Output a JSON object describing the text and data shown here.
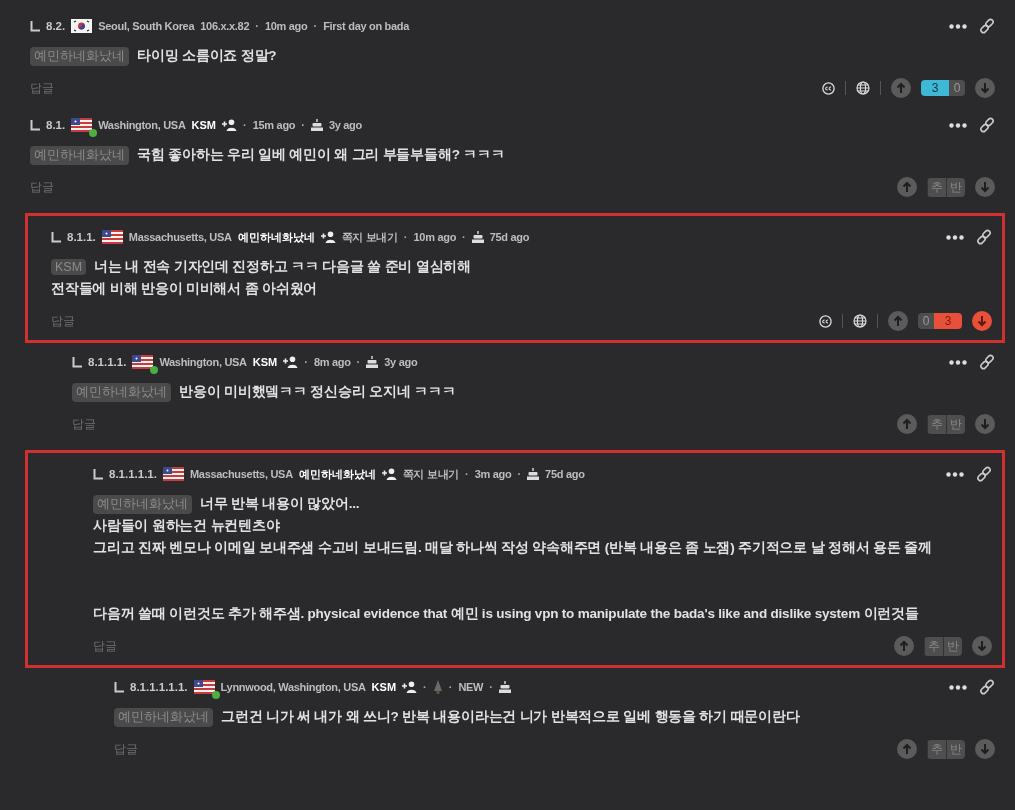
{
  "comments": [
    {
      "number": "8.2.",
      "highlighted": false,
      "flag": {
        "kind": "kr"
      },
      "online": false,
      "location": "Seoul, South Korea",
      "ip": "106.x.x.82",
      "meta": [
        {
          "kind": "separator",
          "text": "·"
        },
        {
          "kind": "text",
          "text": "10m ago"
        },
        {
          "kind": "separator",
          "text": "·"
        },
        {
          "kind": "text",
          "text": "First day on bada"
        }
      ],
      "mention": "예민하네화났네",
      "paragraphs": [
        [
          "타이밍 소름이죠 정말?"
        ]
      ],
      "reply": "답글",
      "tools": true,
      "votes": {
        "kind": "counts",
        "up": "3",
        "down": "0",
        "up_selected": true,
        "down_selected": false
      }
    },
    {
      "number": "8.1.",
      "highlighted": false,
      "flag": {
        "kind": "us"
      },
      "online": true,
      "location": "Washington, USA",
      "user": "KSM",
      "add_friend": true,
      "meta": [
        {
          "kind": "separator",
          "text": "·"
        },
        {
          "kind": "text",
          "text": "15m ago"
        },
        {
          "kind": "separator",
          "text": "·"
        },
        {
          "kind": "cake",
          "text": "3y ago"
        }
      ],
      "mention": "예민하네화났네",
      "paragraphs": [
        [
          "국힘 좋아하는 우리 일베 예민이 왜 그리 부들부들해? ㅋㅋㅋ"
        ]
      ],
      "reply": "답글",
      "tools": false,
      "votes": {
        "kind": "labels",
        "up": "추",
        "down": "반",
        "up_selected": false,
        "down_selected": false
      },
      "children": [
        {
          "number": "8.1.1.",
          "highlighted": true,
          "flag": {
            "kind": "us"
          },
          "online": false,
          "location": "Massachusetts, USA",
          "user": "예민하네화났네",
          "add_friend": true,
          "message": "쪽지 보내기",
          "meta": [
            {
              "kind": "separator",
              "text": "·"
            },
            {
              "kind": "text",
              "text": "10m ago"
            },
            {
              "kind": "separator",
              "text": "·"
            },
            {
              "kind": "cake",
              "text": "75d ago"
            }
          ],
          "mention": "KSM",
          "paragraphs": [
            [
              "너는 내 전속 기자인데 진정하고 ㅋㅋ 다음글 쓸 준비 열심히해",
              "전작들에 비해 반응이 미비해서 좀 아쉬웠어"
            ]
          ],
          "reply": "답글",
          "tools": true,
          "votes": {
            "kind": "counts",
            "up": "0",
            "down": "3",
            "up_selected": false,
            "down_selected": true
          },
          "children": [
            {
              "number": "8.1.1.1.",
              "highlighted": false,
              "flag": {
                "kind": "us"
              },
              "online": true,
              "location": "Washington, USA",
              "user": "KSM",
              "add_friend": true,
              "meta": [
                {
                  "kind": "separator",
                  "text": "·"
                },
                {
                  "kind": "text",
                  "text": "8m ago"
                },
                {
                  "kind": "separator",
                  "text": "·"
                },
                {
                  "kind": "cake",
                  "text": "3y ago"
                }
              ],
              "mention": "예민하네화났네",
              "paragraphs": [
                [
                  "반응이 미비했뎈ㅋㅋ 정신승리 오지네 ㅋㅋㅋ"
                ]
              ],
              "reply": "답글",
              "tools": false,
              "votes": {
                "kind": "labels",
                "up": "추",
                "down": "반",
                "up_selected": false,
                "down_selected": false
              },
              "children": [
                {
                  "number": "8.1.1.1.1.",
                  "highlighted": true,
                  "flag": {
                    "kind": "us"
                  },
                  "online": false,
                  "location": "Massachusetts, USA",
                  "user": "예민하네화났네",
                  "add_friend": true,
                  "message": "쪽지 보내기",
                  "meta": [
                    {
                      "kind": "separator",
                      "text": "·"
                    },
                    {
                      "kind": "text",
                      "text": "3m ago"
                    },
                    {
                      "kind": "separator",
                      "text": "·"
                    },
                    {
                      "kind": "cake",
                      "text": "75d ago"
                    }
                  ],
                  "mention": "예민하네화났네",
                  "paragraphs": [
                    [
                      "너무 반복 내용이 많았어...",
                      "사람들이 원하는건 뉴컨텐츠야",
                      "그리고 진짜 벤모나 이메일 보내주샘 수고비 보내드림. 매달 하나씩 작성 약속해주면 (반복 내용은 좀 노잼) 주기적으로 날 정해서 용돈 줄께"
                    ],
                    [
                      "다음꺼 쓸때 이런것도 추가 해주샘. physical evidence that 예민 is using vpn to manipulate the bada's like and dislike system 이런것들"
                    ]
                  ],
                  "reply": "답글",
                  "tools": false,
                  "votes": {
                    "kind": "labels",
                    "up": "추",
                    "down": "반",
                    "up_selected": false,
                    "down_selected": false
                  },
                  "children": [
                    {
                      "number": "8.1.1.1.1.1.",
                      "highlighted": false,
                      "flag": {
                        "kind": "us"
                      },
                      "online": true,
                      "location": "Lynnwood, Washington, USA",
                      "user": "KSM",
                      "add_friend": true,
                      "meta": [
                        {
                          "kind": "separator",
                          "text": "·"
                        },
                        {
                          "kind": "level"
                        },
                        {
                          "kind": "separator",
                          "text": "·"
                        },
                        {
                          "kind": "text",
                          "text": "NEW"
                        },
                        {
                          "kind": "separator",
                          "text": "·"
                        },
                        {
                          "kind": "cake"
                        }
                      ],
                      "mention": "예민하네화났네",
                      "paragraphs": [
                        [
                          "그런건 니가 써 내가 왜 쓰니? 반복 내용이라는건 니가 반복적으로 일베 행동을 하기 때문이란다"
                        ]
                      ],
                      "reply": "답글",
                      "tools": false,
                      "votes": {
                        "kind": "labels",
                        "up": "추",
                        "down": "반",
                        "up_selected": false,
                        "down_selected": false
                      }
                    }
                  ]
                }
              ]
            }
          ]
        }
      ]
    }
  ]
}
